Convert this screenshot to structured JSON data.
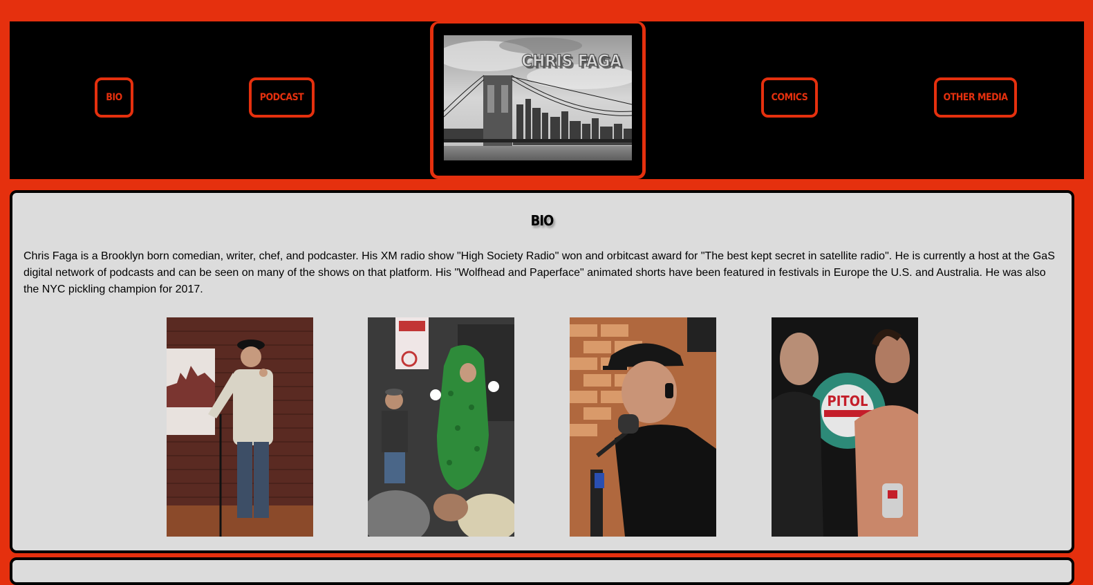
{
  "nav": {
    "bio": "BIO",
    "podcast": "PODCAST",
    "comics": "COMICS",
    "other_media": "OTHER MEDIA"
  },
  "logo": {
    "title": "CHRIS FAGA"
  },
  "bio": {
    "heading": "BIO",
    "text": "Chris Faga is a Brooklyn born comedian, writer, chef, and podcaster. His XM radio show \"High Society Radio\" won and orbitcast award for \"The best kept secret in satellite radio\". He is currently a host at the GaS digital network of podcasts and can be seen on many of the shows on that platform. His \"Wolfhead and Paperface\" animated shorts have been featured in festivals in Europe the U.S. and Australia. He was also the NYC pickling champion for 2017."
  },
  "colors": {
    "brand_red": "#e5300e",
    "header_bg": "#000000",
    "panel_bg": "#dcdcdc"
  }
}
